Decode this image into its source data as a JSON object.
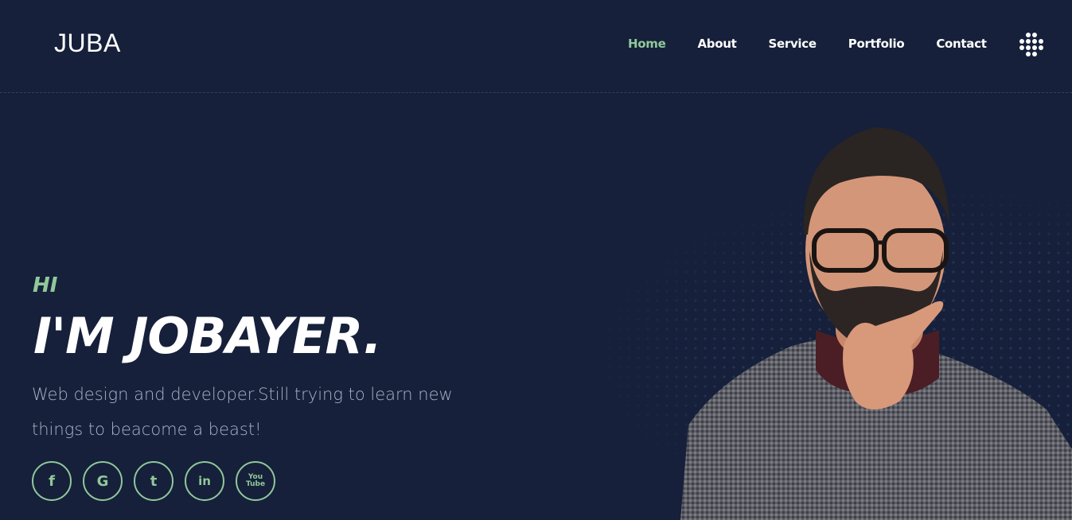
{
  "header": {
    "logo": "JUBA",
    "nav": [
      "Home",
      "About",
      "Service",
      "Portfolio",
      "Contact"
    ],
    "active_nav": "Home",
    "menu_icon": "grid-dots-icon"
  },
  "hero": {
    "greeting": "HI",
    "name": "I'M JOBAYER.",
    "description_line1": "Web design and developer.Still trying to learn new",
    "description_line2": "things to beacome a beast!",
    "socials": [
      {
        "icon": "facebook-icon",
        "glyph": "f"
      },
      {
        "icon": "google-icon",
        "glyph": "G"
      },
      {
        "icon": "tumblr-icon",
        "glyph": "t"
      },
      {
        "icon": "linkedin-icon",
        "glyph": "in"
      },
      {
        "icon": "youtube-icon",
        "glyph_top": "You",
        "glyph_bottom": "Tube"
      }
    ],
    "portrait": "man-with-glasses-and-beard-photo"
  },
  "colors": {
    "background": "#16203a",
    "accent": "#8fc89a",
    "text": "#ffffff",
    "muted": "#a9b0c6"
  }
}
